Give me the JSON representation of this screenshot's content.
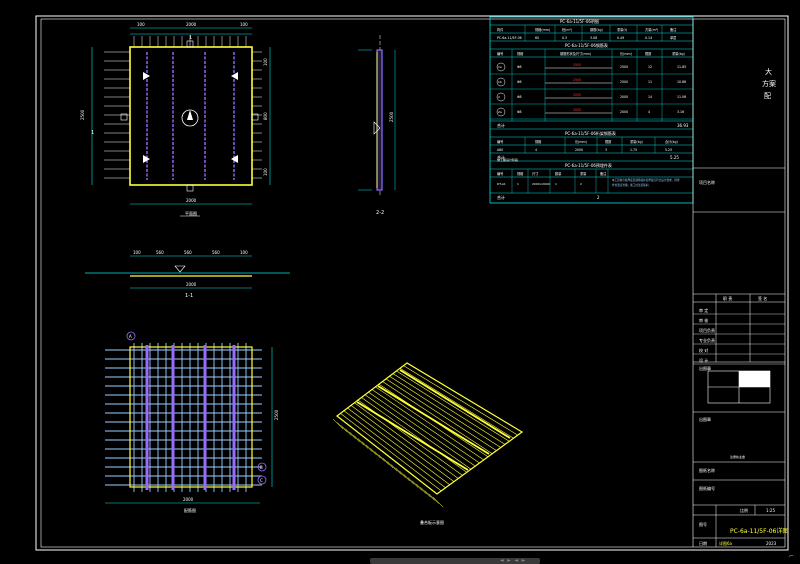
{
  "drawing": {
    "plan_view": {
      "section_mark_top": "1",
      "section_mark_left": "1",
      "dim_top": [
        "100",
        "2000",
        "100"
      ],
      "dim_right_top": "100",
      "dim_right_mid": "800",
      "dim_right_bot": "100",
      "dim_left": "2500",
      "dim_bottom": "2000",
      "label": "平面图"
    },
    "side_view": {
      "label": "2-2",
      "dim_right": "2500"
    },
    "section_1_1": {
      "label": "1-1",
      "dim_top": [
        "100",
        "560",
        "560",
        "560",
        "100"
      ],
      "dim_bottom": "2000"
    },
    "rebar_view": {
      "dim_right": "2500",
      "dim_bottom": "2000",
      "label": "配筋图",
      "tag_top": "A",
      "tag_right_1": "B",
      "tag_right_2": "C"
    },
    "iso_view": {
      "label": "叠合板示意图"
    }
  },
  "schedule": {
    "title1": "PC-6a-11/5F-06明细",
    "headers1": [
      "构件",
      "规格(mm)",
      "砼(m³)",
      "钢筋(kg)",
      "重量(t)",
      "方量(m³)",
      "备注"
    ],
    "row1": [
      "PC-6a-11/5F-06",
      "60",
      "0.3",
      "3.08",
      "0.49",
      "0.14",
      "单层"
    ],
    "title2": "PC-6a-11/5F-06钢筋表",
    "headers2": [
      "编号",
      "规格",
      "钢筋形状及尺寸(mm)",
      "长(mm)",
      "根数",
      "重量(kg)"
    ],
    "rebar_rows": [
      {
        "id": "1a",
        "spec": "Φ8",
        "len": "2500",
        "n": "12",
        "w": "11.85"
      },
      {
        "id": "1b",
        "spec": "Φ8",
        "len": "2500",
        "n": "11",
        "w": "10.86"
      },
      {
        "id": "2",
        "spec": "Φ8",
        "len": "2000",
        "n": "14",
        "w": "11.06"
      },
      {
        "id": "2a",
        "spec": "Φ8",
        "len": "2000",
        "n": "4",
        "w": "3.16"
      }
    ],
    "rebar_total_label": "合计",
    "rebar_total": "36.93",
    "title3": "PC-6a-11/5F-06桁架钢筋表",
    "headers3": [
      "编号",
      "规格",
      "长(mm)",
      "根数",
      "重量(kg)",
      "合计(kg)"
    ],
    "truss_rows": [
      {
        "id": "A80",
        "spec": "4",
        "len": "2000",
        "n": "3",
        "w": "1.75",
        "t": "5.25"
      }
    ],
    "truss_total_label": "合计",
    "truss_total": "5.25",
    "title4": "PC-6a-11/5F-06预埋件表",
    "headers4": [
      "编号",
      "规格",
      "尺寸",
      "数量",
      "重量",
      "备注"
    ],
    "embed_rows": [
      {
        "id": "DT-A1",
        "spec": "1",
        "size": "2000×2000",
        "n": "1",
        "w": "2"
      }
    ],
    "embed_note": "本工程叠合板厚度及钢筋保护层厚度应符合设计要求，预埋件位置应准确，施工时注意保护。",
    "embed_total_label": "合计",
    "embed_total": "2"
  },
  "title_block": {
    "company_line1": "大",
    "company_line2": "方案",
    "company_line3": "配",
    "small_note": "施工图设计阶段",
    "project_label": "项目名称",
    "sign_headers": [
      "职 责",
      "签 名"
    ],
    "roles": [
      "审 定",
      "审 核",
      "项目负责",
      "专业负责",
      "校 对",
      "设 计"
    ],
    "stamp_label": "出图章",
    "stamp_note": "注册执业章",
    "drawing_name_label": "图纸名称",
    "drawing_no_label": "图纸编号",
    "scale_label": "比例",
    "scale_value": "1:25",
    "sheet_label": "图号",
    "sheet_value": "PC-6a-11/5F-06详图",
    "date_label": "日期",
    "date_value": "2023",
    "footer_label": "详图6a"
  },
  "colors": {
    "background": "#000000",
    "frame": "#ffffff",
    "dimension": "#00e5e5",
    "panel": "#ffff3a",
    "truss": "#9a6bff",
    "rebar": "#9ad0ff",
    "text": "#ffffff",
    "red": "#ff3030",
    "yellow_text": "#ffff3a"
  }
}
